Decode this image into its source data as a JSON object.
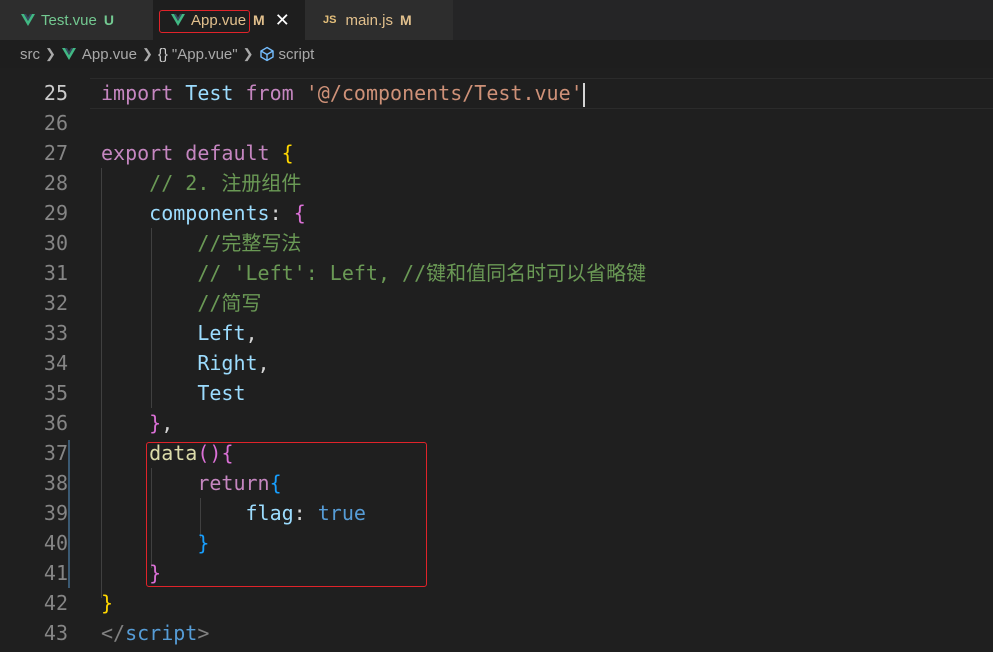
{
  "tabs": [
    {
      "label": "Test.vue",
      "status": "U"
    },
    {
      "label": "App.vue",
      "status": "M"
    },
    {
      "label": "main.js",
      "status": "M",
      "icon_text": "JS"
    }
  ],
  "breadcrumb": {
    "root": "src",
    "file": "App.vue",
    "object": "\"App.vue\"",
    "symbol": "script"
  },
  "editor": {
    "lines": [
      {
        "n": "25",
        "tokens": [
          {
            "t": "import",
            "c": "kw"
          },
          {
            "t": " ",
            "c": "punc"
          },
          {
            "t": "Test",
            "c": "id"
          },
          {
            "t": " ",
            "c": "punc"
          },
          {
            "t": "from",
            "c": "kw"
          },
          {
            "t": " ",
            "c": "punc"
          },
          {
            "t": "'@/components/Test.vue'",
            "c": "str"
          }
        ]
      },
      {
        "n": "26",
        "tokens": []
      },
      {
        "n": "27",
        "tokens": [
          {
            "t": "export",
            "c": "kw"
          },
          {
            "t": " ",
            "c": "punc"
          },
          {
            "t": "default",
            "c": "kw"
          },
          {
            "t": " ",
            "c": "punc"
          },
          {
            "t": "{",
            "c": "brace2"
          }
        ]
      },
      {
        "n": "28",
        "tokens": [
          {
            "t": "    // 2. 注册组件",
            "c": "cmt"
          }
        ]
      },
      {
        "n": "29",
        "tokens": [
          {
            "t": "    ",
            "c": "punc"
          },
          {
            "t": "components",
            "c": "id"
          },
          {
            "t": ": ",
            "c": "punc"
          },
          {
            "t": "{",
            "c": "brace"
          }
        ]
      },
      {
        "n": "30",
        "tokens": [
          {
            "t": "        //完整写法",
            "c": "cmt"
          }
        ]
      },
      {
        "n": "31",
        "tokens": [
          {
            "t": "        // 'Left': Left, //键和值同名时可以省略键",
            "c": "cmt"
          }
        ]
      },
      {
        "n": "32",
        "tokens": [
          {
            "t": "        //简写",
            "c": "cmt"
          }
        ]
      },
      {
        "n": "33",
        "tokens": [
          {
            "t": "        ",
            "c": "punc"
          },
          {
            "t": "Left",
            "c": "id"
          },
          {
            "t": ",",
            "c": "punc"
          }
        ]
      },
      {
        "n": "34",
        "tokens": [
          {
            "t": "        ",
            "c": "punc"
          },
          {
            "t": "Right",
            "c": "id"
          },
          {
            "t": ",",
            "c": "punc"
          }
        ]
      },
      {
        "n": "35",
        "tokens": [
          {
            "t": "        ",
            "c": "punc"
          },
          {
            "t": "Test",
            "c": "id"
          }
        ]
      },
      {
        "n": "36",
        "tokens": [
          {
            "t": "    ",
            "c": "punc"
          },
          {
            "t": "}",
            "c": "brace"
          },
          {
            "t": ",",
            "c": "punc"
          }
        ]
      },
      {
        "n": "37",
        "tokens": [
          {
            "t": "    ",
            "c": "punc"
          },
          {
            "t": "data",
            "c": "fn"
          },
          {
            "t": "()",
            "c": "brace"
          },
          {
            "t": "{",
            "c": "brace"
          }
        ]
      },
      {
        "n": "38",
        "tokens": [
          {
            "t": "        ",
            "c": "punc"
          },
          {
            "t": "return",
            "c": "kw"
          },
          {
            "t": "{",
            "c": "brace3"
          }
        ]
      },
      {
        "n": "39",
        "tokens": [
          {
            "t": "            ",
            "c": "punc"
          },
          {
            "t": "flag",
            "c": "id"
          },
          {
            "t": ": ",
            "c": "punc"
          },
          {
            "t": "true",
            "c": "bool"
          }
        ]
      },
      {
        "n": "40",
        "tokens": [
          {
            "t": "        ",
            "c": "punc"
          },
          {
            "t": "}",
            "c": "brace3"
          }
        ]
      },
      {
        "n": "41",
        "tokens": [
          {
            "t": "    ",
            "c": "punc"
          },
          {
            "t": "}",
            "c": "brace"
          }
        ]
      },
      {
        "n": "42",
        "tokens": [
          {
            "t": "}",
            "c": "brace2"
          }
        ]
      },
      {
        "n": "43",
        "tokens": [
          {
            "t": "</",
            "c": "tagbr"
          },
          {
            "t": "script",
            "c": "tag"
          },
          {
            "t": ">",
            "c": "tagbr"
          }
        ]
      }
    ],
    "active_line": "25"
  }
}
